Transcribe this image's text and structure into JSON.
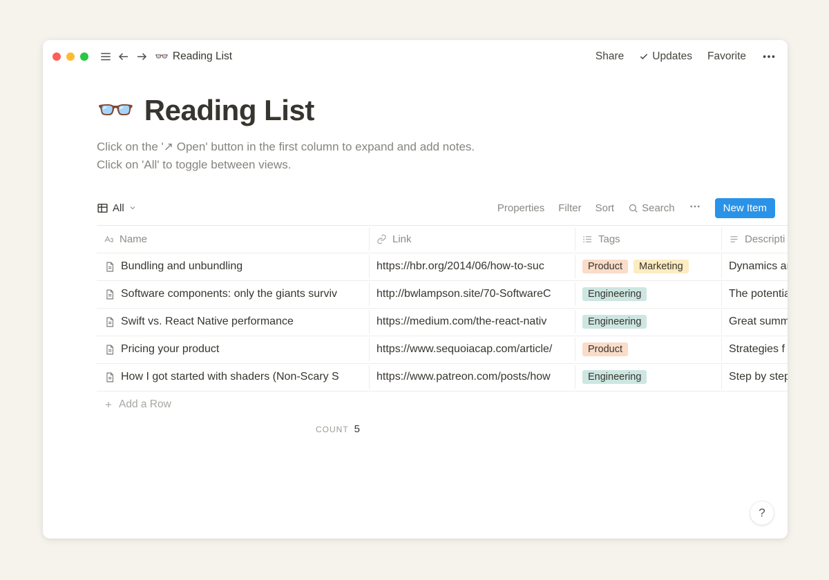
{
  "breadcrumb": {
    "emoji": "👓",
    "title": "Reading List"
  },
  "toolbar": {
    "share": "Share",
    "updates": "Updates",
    "favorite": "Favorite"
  },
  "page": {
    "emoji": "👓",
    "title": "Reading List",
    "desc_line1": "Click on the '↗ Open' button in the first column to expand and add notes.",
    "desc_line2": "Click on 'All' to toggle between views."
  },
  "db": {
    "view_label": "All",
    "actions": {
      "properties": "Properties",
      "filter": "Filter",
      "sort": "Sort",
      "search": "Search"
    },
    "new_item": "New Item",
    "columns": {
      "name": "Name",
      "link": "Link",
      "tags": "Tags",
      "description": "Descripti"
    },
    "rows": [
      {
        "name": "Bundling and unbundling",
        "link": "https://hbr.org/2014/06/how-to-suc",
        "tags": [
          "Product",
          "Marketing"
        ],
        "desc": "Dynamics ar"
      },
      {
        "name": "Software components: only the giants surviv",
        "link": "http://bwlampson.site/70-SoftwareC",
        "tags": [
          "Engineering"
        ],
        "desc": "The potentia"
      },
      {
        "name": "Swift vs. React Native performance",
        "link": "https://medium.com/the-react-nativ",
        "tags": [
          "Engineering"
        ],
        "desc": "Great summ"
      },
      {
        "name": "Pricing your product",
        "link": "https://www.sequoiacap.com/article/",
        "tags": [
          "Product"
        ],
        "desc": "Strategies f"
      },
      {
        "name": "How I got started with shaders (Non-Scary S",
        "link": "https://www.patreon.com/posts/how",
        "tags": [
          "Engineering"
        ],
        "desc": "Step by step"
      }
    ],
    "add_row": "Add a Row",
    "count_label": "COUNT",
    "count_value": "5"
  },
  "tag_colors": {
    "Product": "#fadcc9",
    "Marketing": "#fcecc0",
    "Engineering": "#cde6e1"
  },
  "help_label": "?"
}
